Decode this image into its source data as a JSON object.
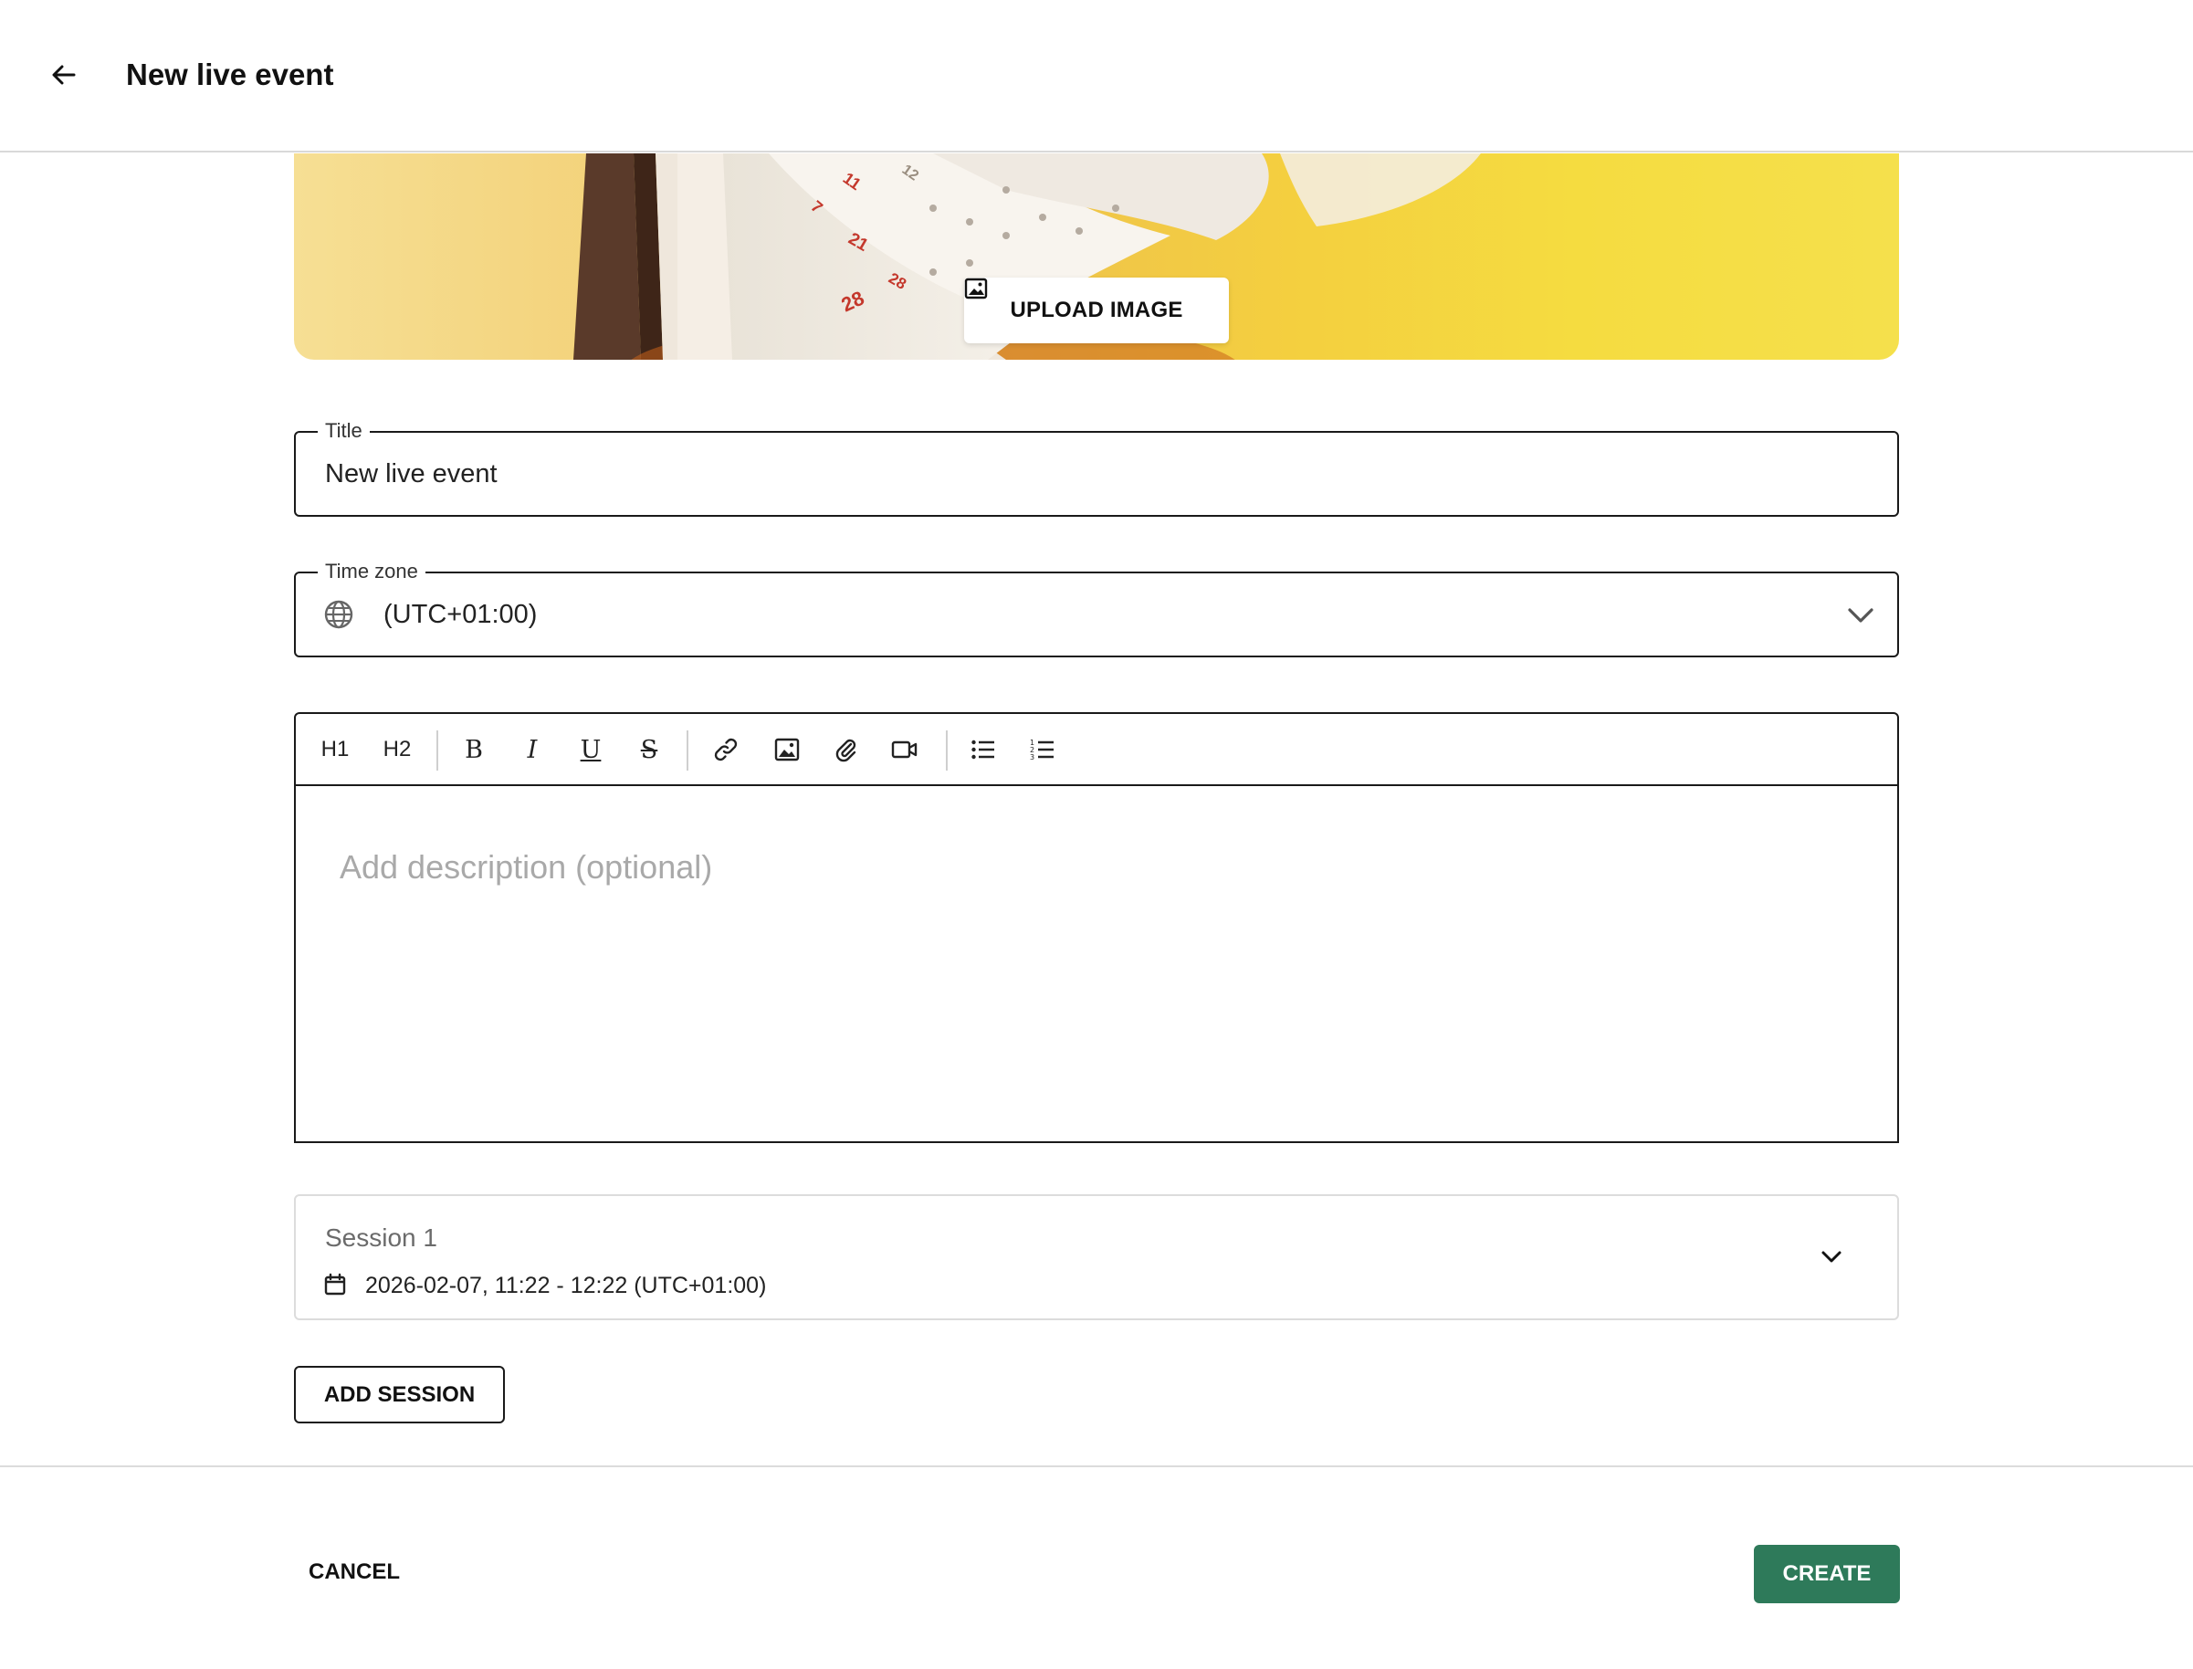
{
  "header": {
    "title": "New live event"
  },
  "banner": {
    "upload_label": "UPLOAD IMAGE",
    "calendar_numbers": [
      "11",
      "12",
      "21",
      "28",
      "28",
      "7"
    ]
  },
  "title_field": {
    "legend": "Title",
    "value": "New live event"
  },
  "timezone_field": {
    "legend": "Time zone",
    "value": "(UTC+01:00)"
  },
  "editor": {
    "toolbar": {
      "h1": "H1",
      "h2": "H2",
      "bold": "B",
      "italic": "I",
      "underline": "U",
      "strike": "S"
    },
    "placeholder": "Add description (optional)"
  },
  "session": {
    "title": "Session 1",
    "time": "2026-02-07, 11:22 - 12:22 (UTC+01:00)"
  },
  "actions": {
    "add_session": "ADD SESSION",
    "cancel": "CANCEL",
    "create": "CREATE"
  },
  "colors": {
    "primary": "#2e7a5a",
    "border": "#1a1a1a",
    "muted_text": "#a9a9a9"
  }
}
